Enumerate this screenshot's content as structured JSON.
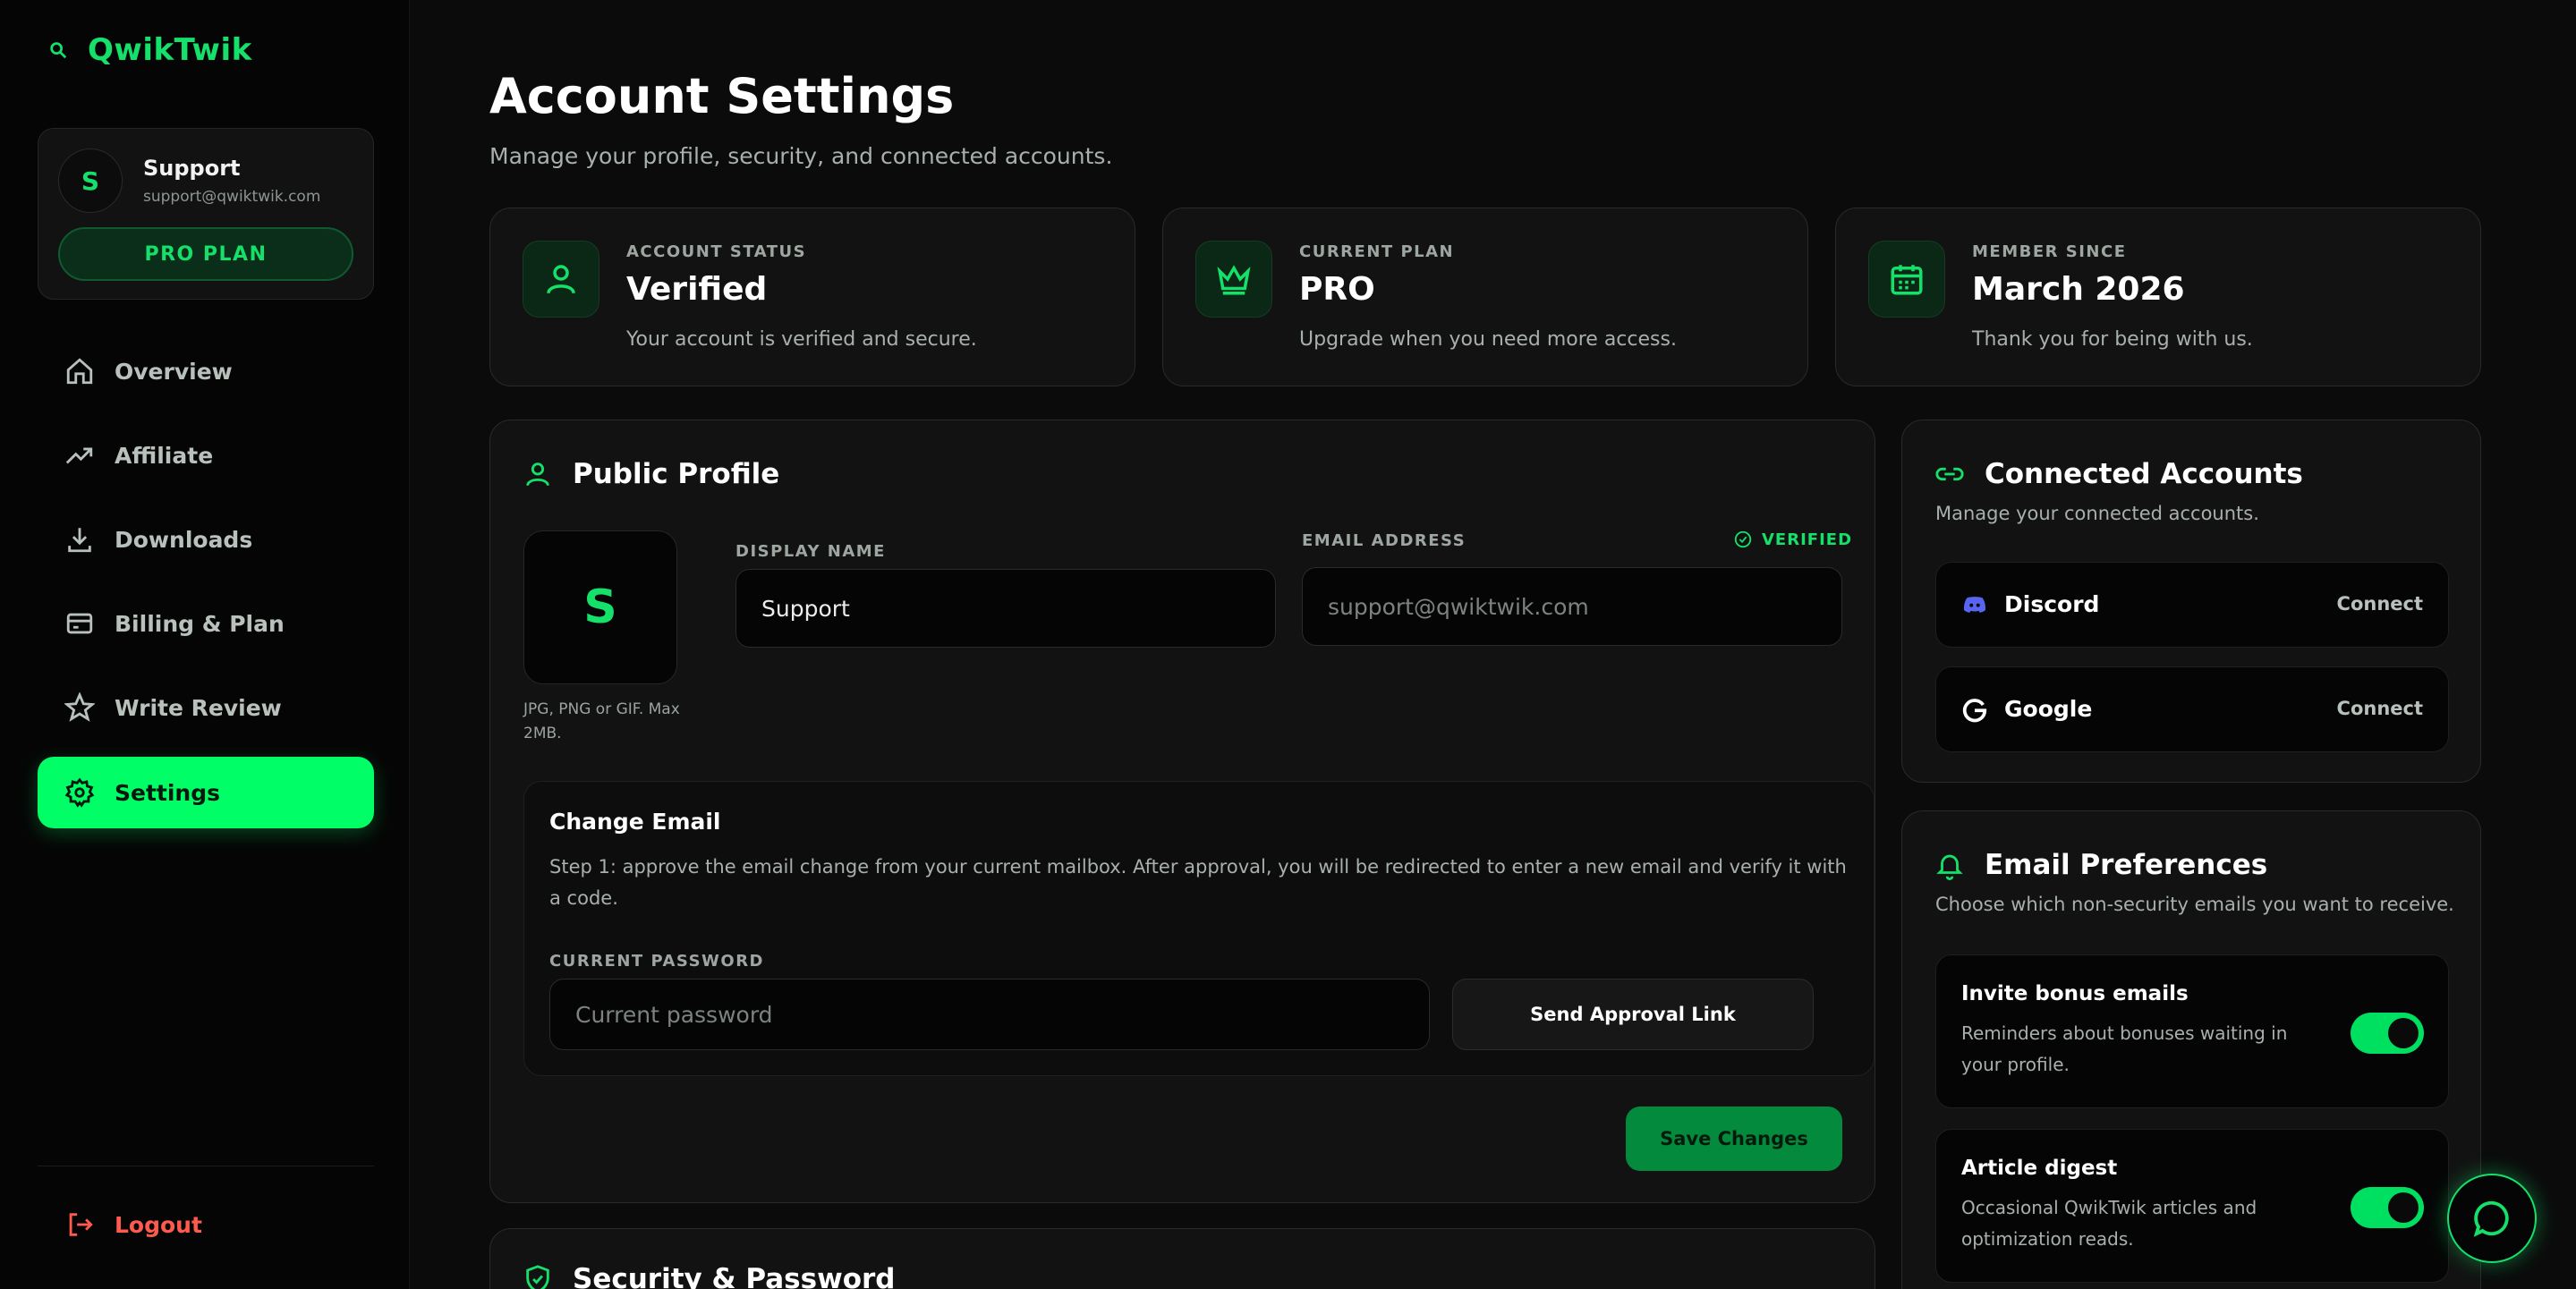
{
  "brand": {
    "name": "QwikTwik",
    "icon": "search-icon"
  },
  "user": {
    "initial": "S",
    "name": "Support",
    "email": "support@qwiktwik.com",
    "plan_badge": "PRO PLAN"
  },
  "nav": {
    "items": [
      {
        "label": "Overview",
        "icon": "home-icon"
      },
      {
        "label": "Affiliate",
        "icon": "trend-icon"
      },
      {
        "label": "Downloads",
        "icon": "download-icon"
      },
      {
        "label": "Billing & Plan",
        "icon": "card-icon"
      },
      {
        "label": "Write Review",
        "icon": "star-icon"
      },
      {
        "label": "Settings",
        "icon": "gear-icon",
        "active": true
      }
    ],
    "logout": "Logout"
  },
  "header": {
    "title": "Account Settings",
    "subtitle": "Manage your profile, security, and connected accounts."
  },
  "stats": [
    {
      "label": "ACCOUNT STATUS",
      "value": "Verified",
      "desc": "Your account is verified and secure.",
      "icon": "user-icon"
    },
    {
      "label": "CURRENT PLAN",
      "value": "PRO",
      "desc": "Upgrade when you need more access.",
      "icon": "crown-icon"
    },
    {
      "label": "MEMBER SINCE",
      "value": "March 2026",
      "desc": "Thank you for being with us.",
      "icon": "calendar-icon"
    }
  ],
  "profile": {
    "title": "Public Profile",
    "avatar_initial": "S",
    "avatar_hint": "JPG, PNG or GIF. Max 2MB.",
    "display_name_label": "DISPLAY NAME",
    "display_name_value": "Support",
    "email_label": "EMAIL ADDRESS",
    "email_placeholder": "support@qwiktwik.com",
    "verified_tag": "VERIFIED",
    "change_email": {
      "title": "Change Email",
      "desc": "Step 1: approve the email change from your current mailbox. After approval, you will be redirected to enter a new email and verify it with a code.",
      "password_label": "CURRENT PASSWORD",
      "password_placeholder": "Current password",
      "send_button": "Send Approval Link"
    },
    "save_button": "Save Changes"
  },
  "security": {
    "title": "Security & Password"
  },
  "connected": {
    "title": "Connected Accounts",
    "desc": "Manage your connected accounts.",
    "accounts": [
      {
        "name": "Discord",
        "action": "Connect",
        "icon": "discord-icon"
      },
      {
        "name": "Google",
        "action": "Connect",
        "icon": "google-icon"
      }
    ]
  },
  "email_prefs": {
    "title": "Email Preferences",
    "desc": "Choose which non-security emails you want to receive.",
    "items": [
      {
        "title": "Invite bonus emails",
        "desc": "Reminders about bonuses waiting in your profile.",
        "enabled": true
      },
      {
        "title": "Article digest",
        "desc": "Occasional QwikTwik articles and optimization reads.",
        "enabled": true
      }
    ]
  },
  "colors": {
    "accent": "#00ff66",
    "brand_green": "#14e06a",
    "danger": "#ff5a4e",
    "background": "#0b0b0b"
  }
}
